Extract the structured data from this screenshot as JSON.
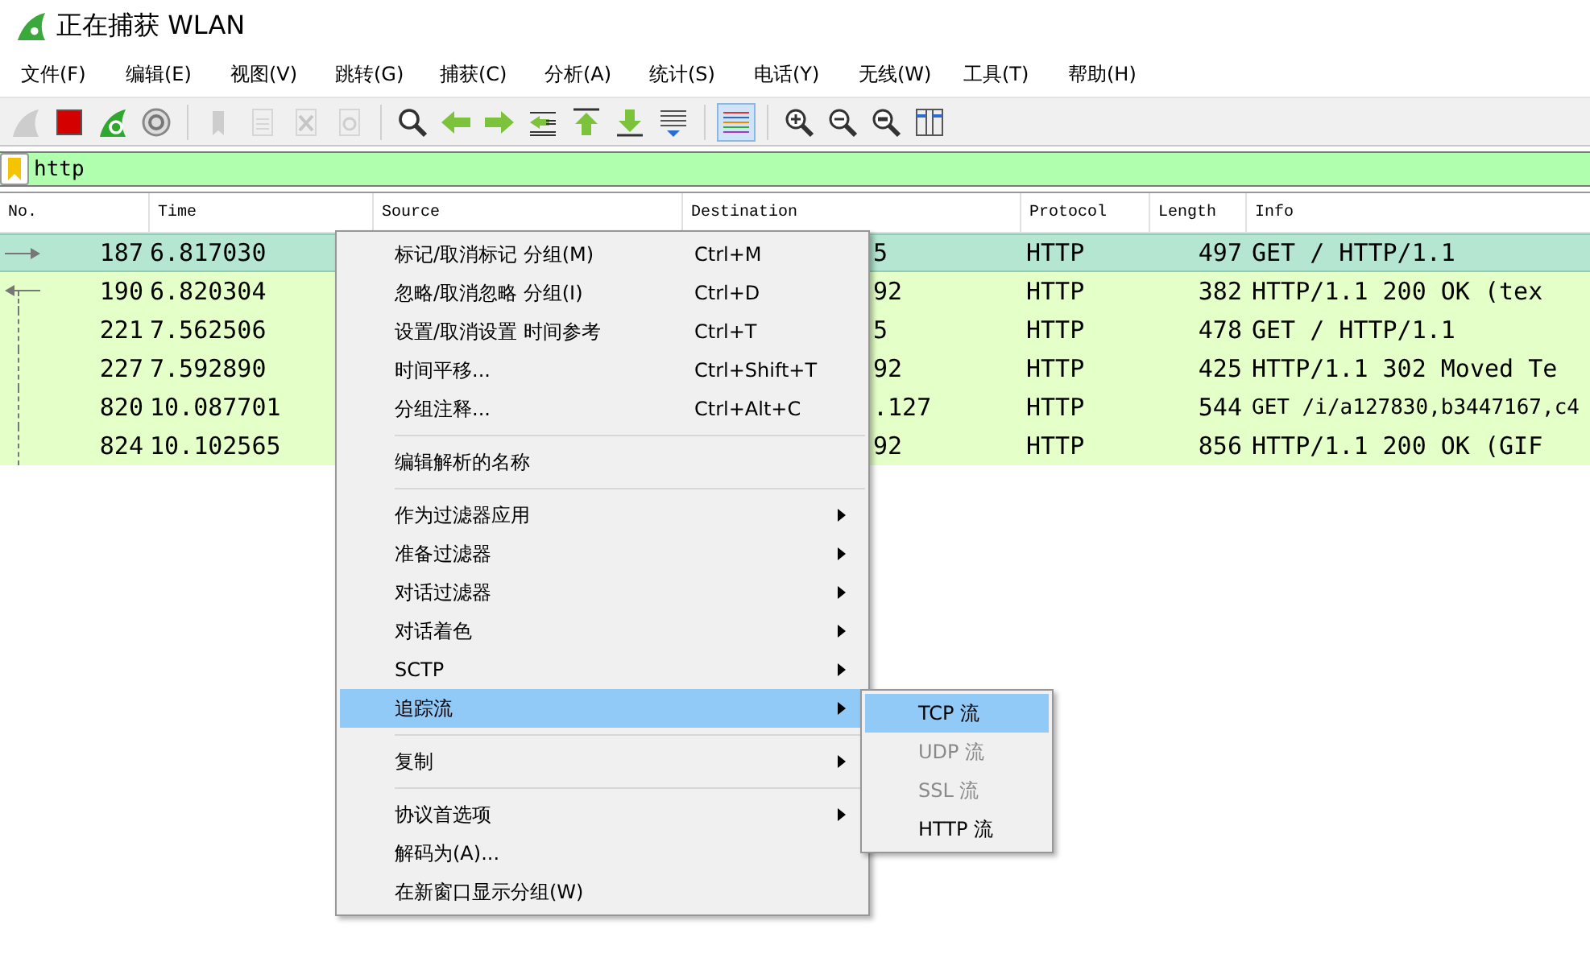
{
  "window": {
    "title": "正在捕获 WLAN"
  },
  "menubar": [
    "文件(F)",
    "编辑(E)",
    "视图(V)",
    "跳转(G)",
    "捕获(C)",
    "分析(A)",
    "统计(S)",
    "电话(Y)",
    "无线(W)",
    "工具(T)",
    "帮助(H)"
  ],
  "toolbar": [
    {
      "kind": "start",
      "disabled": true,
      "pressed": false
    },
    {
      "kind": "stop",
      "disabled": false,
      "pressed": false
    },
    {
      "kind": "restart",
      "disabled": false,
      "pressed": false
    },
    {
      "kind": "options",
      "disabled": false,
      "pressed": false
    },
    {
      "kind": "separator"
    },
    {
      "kind": "open",
      "disabled": true,
      "pressed": false
    },
    {
      "kind": "save",
      "disabled": true,
      "pressed": false
    },
    {
      "kind": "close",
      "disabled": true,
      "pressed": false
    },
    {
      "kind": "reload",
      "disabled": true,
      "pressed": false
    },
    {
      "kind": "separator"
    },
    {
      "kind": "find",
      "disabled": false,
      "pressed": false
    },
    {
      "kind": "back",
      "disabled": false,
      "pressed": false
    },
    {
      "kind": "forward",
      "disabled": false,
      "pressed": false
    },
    {
      "kind": "goto",
      "disabled": false,
      "pressed": false
    },
    {
      "kind": "first",
      "disabled": false,
      "pressed": false
    },
    {
      "kind": "last",
      "disabled": false,
      "pressed": false
    },
    {
      "kind": "autoscroll",
      "disabled": false,
      "pressed": false
    },
    {
      "kind": "separator"
    },
    {
      "kind": "colorize",
      "disabled": false,
      "pressed": true
    },
    {
      "kind": "separator"
    },
    {
      "kind": "zoom-in",
      "disabled": false,
      "pressed": false
    },
    {
      "kind": "zoom-out",
      "disabled": false,
      "pressed": false
    },
    {
      "kind": "zoom-normal",
      "disabled": false,
      "pressed": false
    },
    {
      "kind": "resize",
      "disabled": false,
      "pressed": false
    }
  ],
  "filter": {
    "value": "http"
  },
  "table": {
    "columns": [
      "No.",
      "Time",
      "Source",
      "Destination",
      "Protocol",
      "Length",
      "Info"
    ],
    "rows": [
      {
        "no": "187",
        "time": "6.817030",
        "destination": "5",
        "protocol": "HTTP",
        "length": "497",
        "info": "GET / HTTP/1.1",
        "selected": true,
        "request": true,
        "response": false,
        "in_conversation": false,
        "small_info": false
      },
      {
        "no": "190",
        "time": "6.820304",
        "destination": "92",
        "protocol": "HTTP",
        "length": "382",
        "info": "HTTP/1.1 200 OK  (tex",
        "selected": false,
        "request": false,
        "response": true,
        "in_conversation": true,
        "small_info": false
      },
      {
        "no": "221",
        "time": "7.562506",
        "destination": "5",
        "protocol": "HTTP",
        "length": "478",
        "info": "GET / HTTP/1.1",
        "selected": false,
        "request": false,
        "response": false,
        "in_conversation": true,
        "small_info": false
      },
      {
        "no": "227",
        "time": "7.592890",
        "destination": "92",
        "protocol": "HTTP",
        "length": "425",
        "info": "HTTP/1.1 302 Moved Te",
        "selected": false,
        "request": false,
        "response": false,
        "in_conversation": true,
        "small_info": false
      },
      {
        "no": "820",
        "time": "10.087701",
        "destination": ".127",
        "protocol": "HTTP",
        "length": "544",
        "info": "GET /i/a127830,b3447167,c4",
        "selected": false,
        "request": false,
        "response": false,
        "in_conversation": true,
        "small_info": true
      },
      {
        "no": "824",
        "time": "10.102565",
        "destination": "92",
        "protocol": "HTTP",
        "length": "856",
        "info": "HTTP/1.1 200 OK  (GIF",
        "selected": false,
        "request": false,
        "response": false,
        "in_conversation": true,
        "small_info": false
      }
    ]
  },
  "context_menu": {
    "items": [
      {
        "kind": "item",
        "label": "标记/取消标记 分组(M)",
        "shortcut": "Ctrl+M",
        "submenu": false,
        "selected": false
      },
      {
        "kind": "item",
        "label": "忽略/取消忽略 分组(I)",
        "shortcut": "Ctrl+D",
        "submenu": false,
        "selected": false
      },
      {
        "kind": "item",
        "label": "设置/取消设置 时间参考",
        "shortcut": "Ctrl+T",
        "submenu": false,
        "selected": false
      },
      {
        "kind": "item",
        "label": "时间平移...",
        "shortcut": "Ctrl+Shift+T",
        "submenu": false,
        "selected": false
      },
      {
        "kind": "item",
        "label": "分组注释...",
        "shortcut": "Ctrl+Alt+C",
        "submenu": false,
        "selected": false
      },
      {
        "kind": "separator"
      },
      {
        "kind": "item",
        "label": "编辑解析的名称",
        "submenu": false,
        "selected": false
      },
      {
        "kind": "separator"
      },
      {
        "kind": "item",
        "label": "作为过滤器应用",
        "submenu": true,
        "selected": false
      },
      {
        "kind": "item",
        "label": "准备过滤器",
        "submenu": true,
        "selected": false
      },
      {
        "kind": "item",
        "label": "对话过滤器",
        "submenu": true,
        "selected": false
      },
      {
        "kind": "item",
        "label": "对话着色",
        "submenu": true,
        "selected": false
      },
      {
        "kind": "item",
        "label": "SCTP",
        "submenu": true,
        "selected": false
      },
      {
        "kind": "item",
        "label": "追踪流",
        "submenu": true,
        "selected": true
      },
      {
        "kind": "separator"
      },
      {
        "kind": "item",
        "label": "复制",
        "submenu": true,
        "selected": false
      },
      {
        "kind": "separator"
      },
      {
        "kind": "item",
        "label": "协议首选项",
        "submenu": true,
        "selected": false
      },
      {
        "kind": "item",
        "label": "解码为(A)...",
        "submenu": false,
        "selected": false
      },
      {
        "kind": "item",
        "label": "在新窗口显示分组(W)",
        "submenu": false,
        "selected": false
      }
    ]
  },
  "submenu": {
    "items": [
      {
        "label": "TCP 流",
        "disabled": false,
        "selected": true
      },
      {
        "label": "UDP 流",
        "disabled": true,
        "selected": false
      },
      {
        "label": "SSL 流",
        "disabled": true,
        "selected": false
      },
      {
        "label": "HTTP 流",
        "disabled": false,
        "selected": false
      }
    ]
  }
}
